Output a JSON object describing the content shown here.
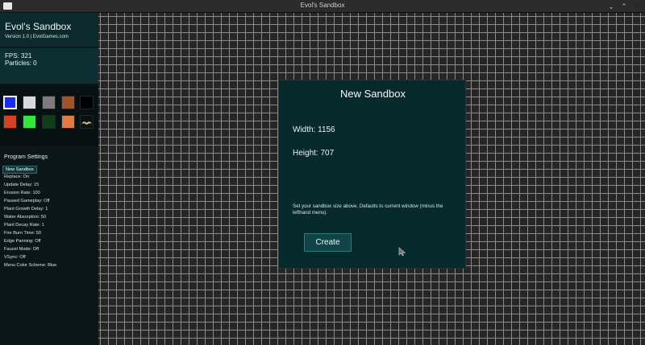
{
  "window": {
    "title": "Evol's Sandbox",
    "min_glyph": "⌄",
    "max_glyph": "⌃",
    "close_glyph": "✕"
  },
  "sidebar": {
    "app_name": "Evol's Sandbox",
    "version": "Version 1.0 | EvolGames.com",
    "fps": "FPS: 321",
    "particles": "Particles: 0"
  },
  "palette": [
    {
      "name": "blue-tile",
      "color": "#1a2bff",
      "selected": true
    },
    {
      "name": "white-tile",
      "color": "#d9d9d9",
      "selected": false
    },
    {
      "name": "gray-stone-tile",
      "color": "#7b7b7b",
      "selected": false
    },
    {
      "name": "brown-dirt-tile",
      "color": "#a0522d",
      "selected": false
    },
    {
      "name": "black-tile",
      "color": "#000000",
      "selected": false
    },
    {
      "name": "red-tile",
      "color": "#d63f22",
      "selected": false
    },
    {
      "name": "green-tile",
      "color": "#2fe83a",
      "selected": false
    },
    {
      "name": "dark-green-tile",
      "color": "#0f3f17",
      "selected": false
    },
    {
      "name": "orange-tile",
      "color": "#e37a44",
      "selected": false
    },
    {
      "name": "bird-icon",
      "color": "#d9c55a",
      "selected": false
    }
  ],
  "settings": {
    "heading": "Program Settings",
    "items": [
      "New Sandbox",
      "Replace: On",
      "Update Delay: 15",
      "Erosion Rate: 100",
      "Paused Gameplay: Off",
      "Plant Growth Delay: 1",
      "Water Absorption: 50",
      "Plant Decay Rate: 1",
      "Fire Burn Time: 50",
      "Edge Panning: Off",
      "Faucet Mode: Off",
      "VSync: Off",
      "Menu Color Scheme: Blue"
    ]
  },
  "dialog": {
    "title": "New Sandbox",
    "width_label": "Width: 1156",
    "height_label": "Height: 707",
    "hint": "Set your sandbox size above. Defaults to current window (minus the lefthand menu).",
    "create_label": "Create"
  }
}
